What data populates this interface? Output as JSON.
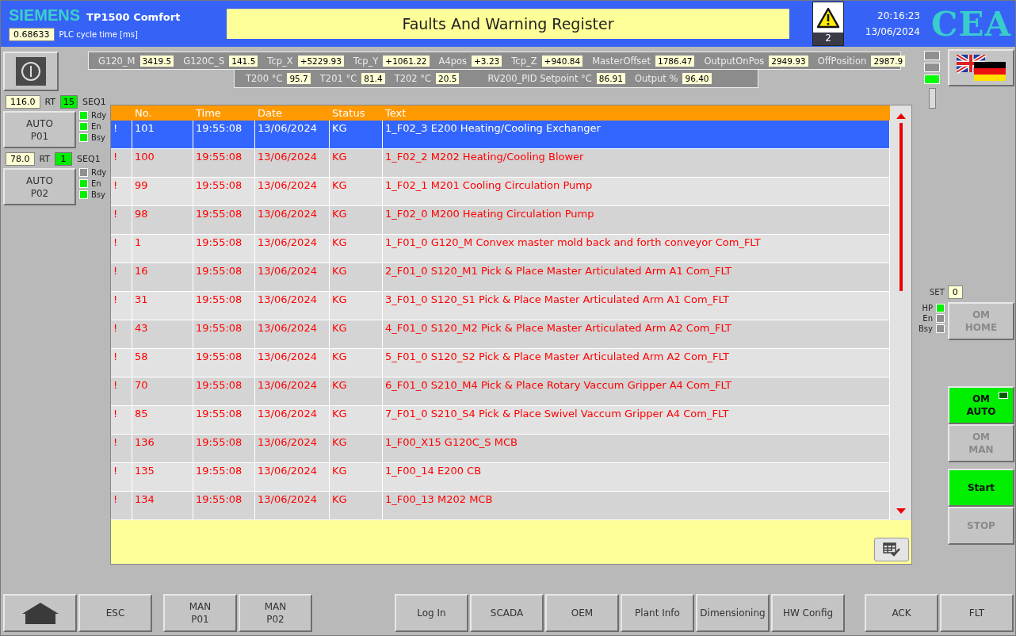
{
  "header": {
    "brand": "SIEMENS",
    "model": "TP1500 Comfort",
    "cycle_time": {
      "value": "0.68633",
      "label": "PLC cycle time [ms]"
    },
    "title": "Faults And Warning Register",
    "alarm_count": "2",
    "time": "20:16:23",
    "date": "13/06/2024",
    "logo": "CEA"
  },
  "telemetry": {
    "row_1": [
      {
        "label": "G120_M",
        "value": "3419.5"
      },
      {
        "label": "G120C_S",
        "value": "141.5"
      },
      {
        "label": "Tcp_X",
        "value": "+5229.93"
      },
      {
        "label": "Tcp_Y",
        "value": "+1061.22"
      },
      {
        "label": "A4pos",
        "value": "+3.23"
      },
      {
        "label": "Tcp_Z",
        "value": "+940.84"
      },
      {
        "label": "MasterOffset",
        "value": "1786.47"
      },
      {
        "label": "OutputOnPos",
        "value": "2949.93"
      },
      {
        "label": "OffPosition",
        "value": "2987.9"
      }
    ],
    "row_2": [
      {
        "label": "T200 °C",
        "value": "95.7"
      },
      {
        "label": "T201 °C",
        "value": "81.4"
      },
      {
        "label": "T202 °C",
        "value": "20.5"
      },
      {
        "label": "RV200_PID Setpoint °C",
        "value": "86.91"
      },
      {
        "label": "Output %",
        "value": "96.40"
      }
    ]
  },
  "pumps": [
    {
      "value": "116.0",
      "rt_label": "RT",
      "seq_value": "15",
      "seq_label": "SEQ1",
      "button": [
        "AUTO",
        "P01"
      ],
      "lamps": [
        {
          "label": "Rdy",
          "on": true
        },
        {
          "label": "En",
          "on": true
        },
        {
          "label": "Bsy",
          "on": true
        }
      ]
    },
    {
      "value": "78.0",
      "rt_label": "RT",
      "seq_value": "1",
      "seq_label": "SEQ1",
      "button": [
        "AUTO",
        "P02"
      ],
      "lamps": [
        {
          "label": "Rdy",
          "on": false
        },
        {
          "label": "En",
          "on": true
        },
        {
          "label": "Bsy",
          "on": true
        }
      ]
    }
  ],
  "table": {
    "columns": [
      "No.",
      "Time",
      "Date",
      "Status",
      "Text"
    ],
    "rows": [
      {
        "mark": "!",
        "no": "101",
        "time": "19:55:08",
        "date": "13/06/2024",
        "status": "KG",
        "text": "1_F02_3 E200 Heating/Cooling Exchanger",
        "selected": true
      },
      {
        "mark": "!",
        "no": "100",
        "time": "19:55:08",
        "date": "13/06/2024",
        "status": "KG",
        "text": "1_F02_2 M202 Heating/Cooling Blower",
        "selected": false
      },
      {
        "mark": "!",
        "no": "99",
        "time": "19:55:08",
        "date": "13/06/2024",
        "status": "KG",
        "text": "1_F02_1 M201 Cooling Circulation Pump",
        "selected": false
      },
      {
        "mark": "!",
        "no": "98",
        "time": "19:55:08",
        "date": "13/06/2024",
        "status": "KG",
        "text": "1_F02_0 M200 Heating Circulation Pump",
        "selected": false
      },
      {
        "mark": "!",
        "no": "1",
        "time": "19:55:08",
        "date": "13/06/2024",
        "status": "KG",
        "text": "1_F01_0 G120_M Convex master mold back and forth conveyor Com_FLT",
        "selected": false
      },
      {
        "mark": "!",
        "no": "16",
        "time": "19:55:08",
        "date": "13/06/2024",
        "status": "KG",
        "text": "2_F01_0 S120_M1 Pick & Place Master Articulated Arm A1 Com_FLT",
        "selected": false
      },
      {
        "mark": "!",
        "no": "31",
        "time": "19:55:08",
        "date": "13/06/2024",
        "status": "KG",
        "text": "3_F01_0 S120_S1 Pick & Place Master Articulated Arm A1 Com_FLT",
        "selected": false
      },
      {
        "mark": "!",
        "no": "43",
        "time": "19:55:08",
        "date": "13/06/2024",
        "status": "KG",
        "text": "4_F01_0 S120_M2 Pick & Place Master Articulated Arm A2 Com_FLT",
        "selected": false
      },
      {
        "mark": "!",
        "no": "58",
        "time": "19:55:08",
        "date": "13/06/2024",
        "status": "KG",
        "text": "5_F01_0 S120_S2 Pick & Place Master Articulated Arm A2 Com_FLT",
        "selected": false
      },
      {
        "mark": "!",
        "no": "70",
        "time": "19:55:08",
        "date": "13/06/2024",
        "status": "KG",
        "text": "6_F01_0 S210_M4 Pick & Place Rotary Vaccum Gripper A4 Com_FLT",
        "selected": false
      },
      {
        "mark": "!",
        "no": "85",
        "time": "19:55:08",
        "date": "13/06/2024",
        "status": "KG",
        "text": "7_F01_0 S210_S4 Pick & Place Swivel Vaccum Gripper A4 Com_FLT",
        "selected": false
      },
      {
        "mark": "!",
        "no": "136",
        "time": "19:55:08",
        "date": "13/06/2024",
        "status": "KG",
        "text": "1_F00_X15 G120C_S MCB",
        "selected": false
      },
      {
        "mark": "!",
        "no": "135",
        "time": "19:55:08",
        "date": "13/06/2024",
        "status": "KG",
        "text": "1_F00_14 E200 CB",
        "selected": false
      },
      {
        "mark": "!",
        "no": "134",
        "time": "19:55:08",
        "date": "13/06/2024",
        "status": "KG",
        "text": "1_F00_13 M202 MCB",
        "selected": false
      }
    ]
  },
  "right_panel": {
    "lamps": [
      {
        "on": false
      },
      {
        "on": false
      },
      {
        "on": true
      }
    ],
    "set": {
      "label": "SET",
      "value": "0"
    },
    "home_lamps": [
      {
        "label": "HP",
        "on": true
      },
      {
        "label": "En",
        "on": false
      },
      {
        "label": "Bsy",
        "on": false
      }
    ],
    "mode_buttons": [
      {
        "lines": [
          "OM",
          "HOME"
        ],
        "active": false
      },
      {
        "lines": [
          "OM",
          "AUTO"
        ],
        "active": true,
        "lamp_on": false
      },
      {
        "lines": [
          "OM",
          "MAN"
        ],
        "active": false
      },
      {
        "lines": [
          "Start"
        ],
        "active": true
      },
      {
        "lines": [
          "STOP"
        ],
        "active": false
      }
    ]
  },
  "footer": {
    "groups": [
      [
        {
          "kind": "home"
        },
        {
          "kind": "text",
          "lines": [
            "ESC"
          ]
        }
      ],
      [
        {
          "kind": "text",
          "lines": [
            "MAN",
            "P01"
          ]
        },
        {
          "kind": "text",
          "lines": [
            "MAN",
            "P02"
          ]
        }
      ],
      [
        {
          "kind": "text",
          "lines": [
            "Log In"
          ]
        },
        {
          "kind": "text",
          "lines": [
            "SCADA"
          ]
        },
        {
          "kind": "text",
          "lines": [
            "OEM"
          ]
        },
        {
          "kind": "text",
          "lines": [
            "Plant Info"
          ]
        },
        {
          "kind": "text",
          "lines": [
            "Dimensioning"
          ]
        },
        {
          "kind": "text",
          "lines": [
            "HW Config"
          ]
        }
      ],
      [
        {
          "kind": "text",
          "lines": [
            "ACK"
          ]
        },
        {
          "kind": "text",
          "lines": [
            "FLT"
          ]
        }
      ]
    ]
  }
}
